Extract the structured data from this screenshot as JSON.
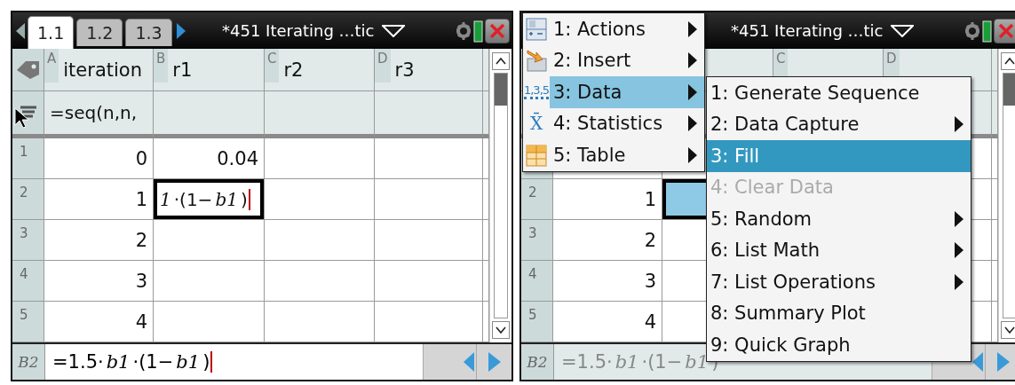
{
  "screens": [
    {
      "tabs": [
        {
          "label": "1.1",
          "selected": true
        },
        {
          "label": "1.2",
          "selected": false
        },
        {
          "label": "1.3",
          "selected": false
        }
      ],
      "title": "*451 Iterating …tic",
      "columns": [
        {
          "letter": "A",
          "name": "iteration"
        },
        {
          "letter": "B",
          "name": "r1"
        },
        {
          "letter": "C",
          "name": "r2"
        },
        {
          "letter": "D",
          "name": "r3"
        }
      ],
      "formulas": [
        "=seq(n,n,"
      ],
      "mouse_pointer": true,
      "rows": [
        {
          "number": "1",
          "cells": [
            "0",
            "0.04"
          ]
        },
        {
          "number": "2",
          "cells": [
            "1",
            {
              "text": "*1*·(1−*b1*)",
              "selected": true,
              "highlighted": false
            }
          ]
        },
        {
          "number": "3",
          "cells": [
            "2"
          ]
        },
        {
          "number": "4",
          "cells": [
            "3"
          ]
        },
        {
          "number": "5",
          "cells": [
            "4"
          ]
        }
      ],
      "entry": {
        "cell": "B2",
        "formula": "=1.5·*b1*·(1−*b1*)",
        "disabled": false
      }
    },
    {
      "title": "*451 Iterating …tic",
      "columns": [
        null,
        null,
        {
          "letter": "C"
        },
        {
          "letter": "D"
        }
      ],
      "rows": [
        null,
        {
          "number": "2",
          "cells": [
            "1",
            {
              "selected": true,
              "highlighted": true
            }
          ]
        },
        {
          "number": "3",
          "cells": [
            "2"
          ]
        },
        {
          "number": "4",
          "cells": [
            "3"
          ]
        },
        {
          "number": "5",
          "cells": [
            "4"
          ]
        }
      ],
      "entry": {
        "cell": "B2",
        "formula": "=1.5·*b1*·(1−*b1*)",
        "disabled": true
      },
      "menu": {
        "items": [
          {
            "label": "1: Actions",
            "kind": "actions",
            "has_submenu": true,
            "selected": false
          },
          {
            "label": "2: Insert",
            "kind": "insert",
            "has_submenu": true,
            "selected": false
          },
          {
            "label": "3: Data",
            "kind": "data",
            "icon_text": "1,3,5",
            "has_submenu": true,
            "selected": true,
            "submenu": {
              "items": [
                {
                  "label": "1: Generate Sequence",
                  "has_submenu": false,
                  "selected": false,
                  "disabled": false
                },
                {
                  "label": "2: Data Capture",
                  "has_submenu": true,
                  "selected": false,
                  "disabled": false
                },
                {
                  "label": "3: Fill",
                  "has_submenu": false,
                  "selected": true,
                  "disabled": false
                },
                {
                  "label": "4: Clear Data",
                  "has_submenu": false,
                  "selected": false,
                  "disabled": true
                },
                {
                  "label": "5: Random",
                  "has_submenu": true,
                  "selected": false,
                  "disabled": false
                },
                {
                  "label": "6: List Math",
                  "has_submenu": true,
                  "selected": false,
                  "disabled": false
                },
                {
                  "label": "7: List Operations",
                  "has_submenu": true,
                  "selected": false,
                  "disabled": false
                },
                {
                  "label": "8: Summary Plot",
                  "has_submenu": false,
                  "selected": false,
                  "disabled": false
                },
                {
                  "label": "9: Quick Graph",
                  "has_submenu": false,
                  "selected": false,
                  "disabled": false
                }
              ]
            }
          },
          {
            "label": "4: Statistics",
            "kind": "statistics",
            "icon_text": "X̄",
            "has_submenu": true,
            "selected": false
          },
          {
            "label": "5: Table",
            "kind": "table",
            "has_submenu": true,
            "selected": false
          }
        ]
      }
    }
  ]
}
